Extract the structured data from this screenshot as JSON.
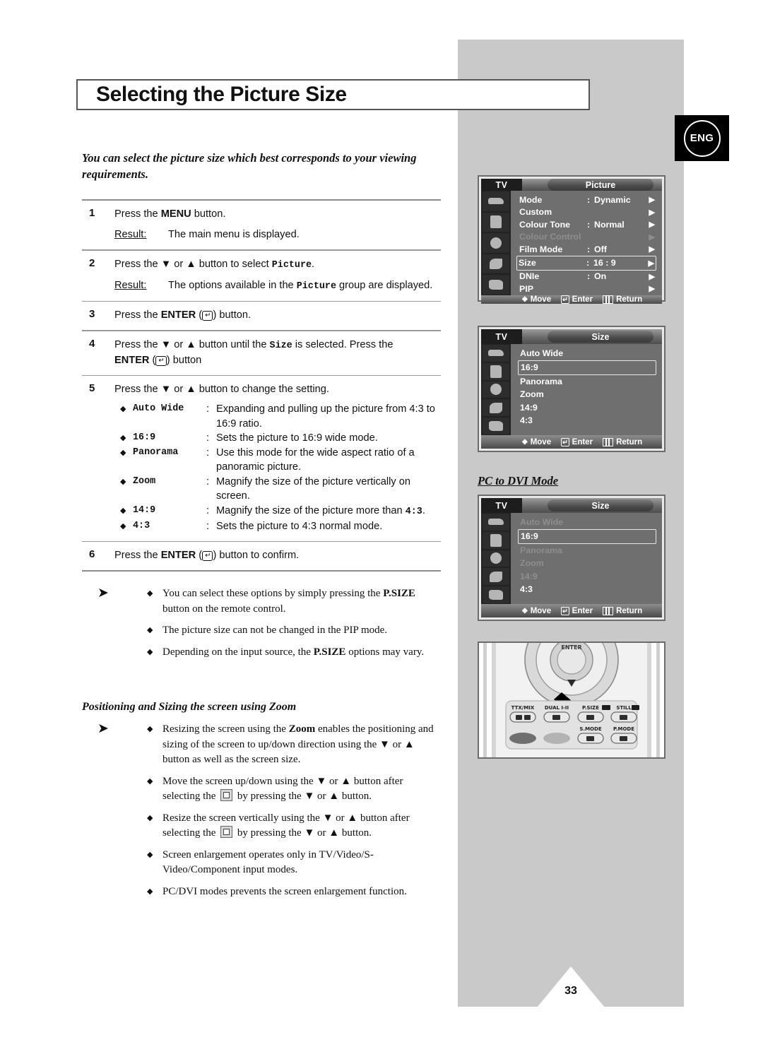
{
  "page": {
    "title": "Selecting the Picture Size",
    "language_badge": "ENG",
    "number": "33"
  },
  "intro": "You can select the picture size which best corresponds to your viewing requirements.",
  "steps": [
    {
      "num": "1",
      "text_before": "Press the ",
      "bold": "MENU",
      "text_after": " button.",
      "result_label": "Result:",
      "result_text": "The main menu is displayed."
    },
    {
      "num": "2",
      "text_before": "Press the ▼ or ▲ button to select ",
      "mono": "Picture",
      "text_after": ".",
      "result_label": "Result:",
      "result_pre": "The options available in the ",
      "result_mono": "Picture",
      "result_post": " group are displayed."
    },
    {
      "num": "3",
      "text_before": "Press the ",
      "bold": "ENTER",
      "text_after": " button."
    },
    {
      "num": "4",
      "text_before": "Press the ▼ or ▲ button until the ",
      "mono": "Size",
      "text_mid": " is selected. Press the ",
      "bold": "ENTER",
      "text_after": " button"
    },
    {
      "num": "5",
      "text_before": "Press the ▼ or ▲ button to change the setting."
    },
    {
      "num": "6",
      "text_before": "Press the ",
      "bold": "ENTER",
      "text_after": " button to confirm."
    }
  ],
  "size_options": [
    {
      "name": "Auto Wide",
      "desc": "Expanding and pulling up the picture from 4:3 to 16:9 ratio."
    },
    {
      "name": "16:9",
      "desc": "Sets the picture to 16:9 wide mode."
    },
    {
      "name": "Panorama",
      "desc": "Use this mode for the wide aspect ratio of a panoramic picture."
    },
    {
      "name": "Zoom",
      "desc": "Magnify the size of the picture vertically on screen."
    },
    {
      "name": "14:9",
      "desc": "Magnify the size of the picture more than 4:3."
    },
    {
      "name": "4:3",
      "desc": "Sets the picture to 4:3 normal mode."
    }
  ],
  "notes_group_1": [
    {
      "pre": "You can select these options by simply pressing the ",
      "bold": "P.SIZE",
      "post": " button on the remote control."
    },
    {
      "pre": "The picture size can not be changed in the PIP mode.",
      "bold": "",
      "post": ""
    },
    {
      "pre": "Depending on the input source, the ",
      "bold": "P.SIZE",
      "post": " options may vary."
    }
  ],
  "subheading": "Positioning and Sizing the screen using Zoom",
  "notes_group_2": [
    {
      "pre": "Resizing the screen using the ",
      "bold": "Zoom",
      "post": " enables the positioning and sizing of the screen to up/down direction using the ▼ or ▲ button as well as the screen size."
    },
    {
      "pre": "Move the screen up/down using the ▼ or ▲ button after selecting the ",
      "icon": "move-screen-icon",
      "post": " by pressing the ▼ or ▲ button."
    },
    {
      "pre": "Resize the screen vertically using the ▼ or ▲ button after selecting the ",
      "icon": "resize-screen-icon",
      "post": " by pressing the ▼ or ▲ button."
    },
    {
      "pre": "Screen enlargement operates only in TV/Video/S-Video/Component input modes.",
      "bold": "",
      "post": ""
    },
    {
      "pre": "PC/DVI modes prevents the screen enlargement function.",
      "bold": "",
      "post": ""
    }
  ],
  "osd_picture": {
    "source_label": "TV",
    "title": "Picture",
    "rows": [
      {
        "label": "Mode",
        "colon": ":",
        "value": "Dynamic",
        "arrow": "▶",
        "state": "normal"
      },
      {
        "label": "Custom",
        "colon": "",
        "value": "",
        "arrow": "▶",
        "state": "normal"
      },
      {
        "label": "Colour Tone",
        "colon": ":",
        "value": "Normal",
        "arrow": "▶",
        "state": "normal"
      },
      {
        "label": "Colour Control",
        "colon": "",
        "value": "",
        "arrow": "▶",
        "state": "dim"
      },
      {
        "label": "Film Mode",
        "colon": ":",
        "value": "Off",
        "arrow": "▶",
        "state": "normal"
      },
      {
        "label": "Size",
        "colon": ":",
        "value": "16 : 9",
        "arrow": "▶",
        "state": "selected"
      },
      {
        "label": "DNIe",
        "colon": ":",
        "value": "On",
        "arrow": "▶",
        "state": "normal"
      },
      {
        "label": "PIP",
        "colon": "",
        "value": "",
        "arrow": "▶",
        "state": "normal"
      }
    ],
    "footer": {
      "move": "Move",
      "enter": "Enter",
      "return": "Return"
    }
  },
  "osd_size": {
    "source_label": "TV",
    "title": "Size",
    "items": [
      {
        "label": "Auto Wide",
        "state": "normal"
      },
      {
        "label": "16:9",
        "state": "selected"
      },
      {
        "label": "Panorama",
        "state": "normal"
      },
      {
        "label": "Zoom",
        "state": "normal"
      },
      {
        "label": "14:9",
        "state": "normal"
      },
      {
        "label": "4:3",
        "state": "normal"
      }
    ],
    "footer": {
      "move": "Move",
      "enter": "Enter",
      "return": "Return"
    }
  },
  "pc_dvi_heading": "PC to DVI Mode",
  "osd_size_pcdvi": {
    "source_label": "TV",
    "title": "Size",
    "items": [
      {
        "label": "Auto Wide",
        "state": "dim"
      },
      {
        "label": "16:9",
        "state": "selected"
      },
      {
        "label": "Panorama",
        "state": "dim"
      },
      {
        "label": "Zoom",
        "state": "dim"
      },
      {
        "label": "14:9",
        "state": "dim"
      },
      {
        "label": "4:3",
        "state": "normal"
      }
    ],
    "footer": {
      "move": "Move",
      "enter": "Enter",
      "return": "Return"
    }
  },
  "remote": {
    "enter_label": "ENTER",
    "buttons": [
      {
        "label": "TTX/MIX"
      },
      {
        "label": "DUAL I-II"
      },
      {
        "label": "P.SIZE"
      },
      {
        "label": "STILL"
      },
      {
        "label": "S.MODE"
      },
      {
        "label": "P.MODE"
      }
    ]
  }
}
